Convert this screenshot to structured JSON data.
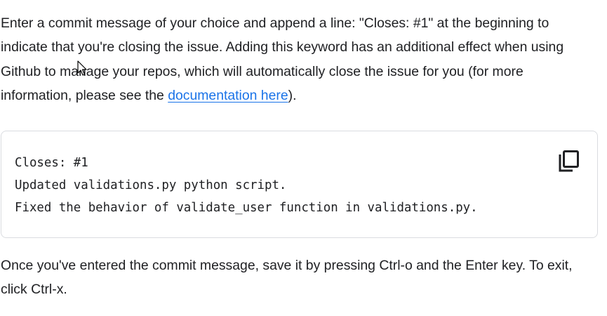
{
  "instructions": {
    "part1": "Enter a commit message of your choice and append a line: \"Closes: #1\" at the beginning to indicate that you're closing the issue. Adding this keyword has an additional effect when using Github to manage your repos, which will automatically close the issue for you (for more information, please see the ",
    "link_text": "documentation here",
    "part2": ")."
  },
  "code_block": {
    "lines": [
      "Closes: #1",
      "Updated validations.py python script.",
      "Fixed the behavior of validate_user function in validations.py."
    ],
    "copy_icon": "copy-icon"
  },
  "followup": {
    "text": "Once you've entered the commit message, save it by pressing Ctrl-o and the Enter key. To exit, click Ctrl-x."
  },
  "colors": {
    "text": "#202124",
    "link": "#1a73e8",
    "border": "#dadce0"
  }
}
